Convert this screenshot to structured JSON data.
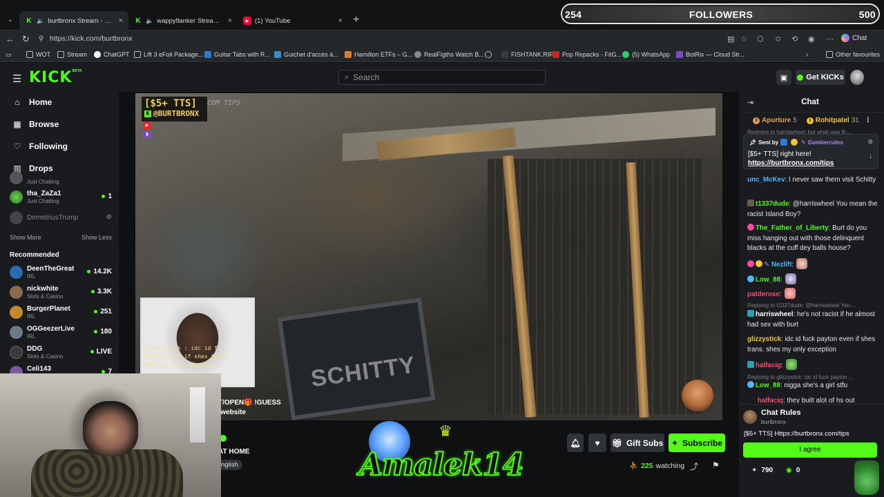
{
  "tabs": [
    {
      "label": "burtbronx Stream - Watch Live"
    },
    {
      "label": "wappyflanker Stream - Watch"
    },
    {
      "label": "(1) YouTube"
    }
  ],
  "followers": {
    "current": "254",
    "label": "FOLLOWERS",
    "goal": "500"
  },
  "address": {
    "url": "https://kick.com/burtbronx",
    "chat_label": "Chat"
  },
  "bookmarks": [
    "WOT",
    "Stream",
    "ChatGPT",
    "Lift 3 eFoil Package...",
    "Guitar Tabs with R...",
    "Guichet d'accès à...",
    "Hamilton ETFs – G...",
    "RealFigths Watch B...",
    "FISHTANK.RIP",
    "Pop Repacks - FitG...",
    "(5) WhatsApp",
    "BotRix — Cloud Str..."
  ],
  "bookmarks_other": "Other favourites",
  "header": {
    "logo": "KICK",
    "logo_tag": "BETA",
    "search_placeholder": "Search",
    "get_kicks": "Get KICKs"
  },
  "sidebar": {
    "nav": [
      {
        "label": "Home"
      },
      {
        "label": "Browse"
      },
      {
        "label": "Following"
      },
      {
        "label": "Drops"
      }
    ],
    "following": [
      {
        "name": "",
        "category": "Just Chatting",
        "viewers": ""
      },
      {
        "name": "tha_ZaZa1",
        "category": "Just Chatting",
        "viewers": "1"
      },
      {
        "name": "DemetriusTrump",
        "category": "",
        "viewers": ""
      }
    ],
    "show_more": "Show More",
    "show_less": "Show Less",
    "recommended_title": "Recommended",
    "recommended": [
      {
        "name": "DeenTheGreat",
        "category": "IRL",
        "viewers": "14.2K",
        "color": "#2b6cb0"
      },
      {
        "name": "nickwhite",
        "category": "Slots & Casino",
        "viewers": "3.3K",
        "color": "#8a6a4a"
      },
      {
        "name": "BurgerPlanet",
        "category": "IRL",
        "viewers": "251",
        "color": "#c48a2a"
      },
      {
        "name": "OGGeezerLive",
        "category": "IRL",
        "viewers": "180",
        "color": "#6a7a8a"
      },
      {
        "name": "DDG",
        "category": "Slots & Casino",
        "viewers": "LIVE",
        "color": "#3a3a3a"
      },
      {
        "name": "Celi143",
        "category": "",
        "viewers": "7",
        "color": "#7a5a9a"
      }
    ]
  },
  "video": {
    "tts_title": "[$5+ TTS]",
    "tts_handle": "@BURTBRONX",
    "com_tips": "COM TIPS",
    "sign_text": "SCHITTY",
    "cam_overlay": "glizzystick : idc id f\npayton even if shes trans.\nshes my only exception"
  },
  "channel_bar": {
    "ticker_line1": "T/OPEN🎁 !GUESS",
    "ticker_line2": "!website",
    "title_fragment": "AT HOME",
    "language": "nglish",
    "overlay_brand": "Amalek14",
    "gift_subs": "Gift Subs",
    "subscribe": "Subscribe",
    "watching_count": "225",
    "watching_label": "watching"
  },
  "chat": {
    "title": "Chat",
    "gifters": [
      {
        "name": "Apurture",
        "count": "5",
        "rank": "3",
        "color": "#e8a060"
      },
      {
        "name": "Rohitpatel",
        "count": "31",
        "rank": "1",
        "color": "#f4c430"
      }
    ],
    "top_reply": "Replying to harriswheel: but what was th...",
    "pinned": {
      "sent_by": "Sent by",
      "sender": "Gumbercules",
      "text": "[$5+ TTS] right here!",
      "link": "https://burtbronx.com/tips"
    },
    "messages": [
      {
        "user": "unc_McKev",
        "color": "#4fb8ff",
        "text": " I never saw them visit Schitty",
        "reply": ""
      },
      {
        "user": "t1337dude",
        "color": "#53fc18",
        "text": " @harriswheel You mean the racist Island Boy?",
        "reply": ""
      },
      {
        "user": "The_Father_of_Liberty",
        "color": "#53fc18",
        "text": " Burt do you miss hanging out with those delinquent blacks at the cuff dey balls house?",
        "reply": ""
      },
      {
        "user": "Nezlift",
        "color": "#4fb8ff",
        "text": "",
        "reply": ""
      },
      {
        "user": "Low_88",
        "color": "#53fc18",
        "text": "",
        "reply": ""
      },
      {
        "user": "patderose",
        "color": "#ff4a6e",
        "text": "",
        "reply": ""
      },
      {
        "user": "harriswheel",
        "color": "#ffffff",
        "text": " he's not racist if he almost had sex with burt",
        "reply": "Replying to t1337dude: @harriswheel You ..."
      },
      {
        "user": "glizzystick",
        "color": "#f4c430",
        "text": " idc id fuck payton even if shes trans. shes my only exception",
        "reply": ""
      },
      {
        "user": "halfacig",
        "color": "#ff4a6e",
        "text": "",
        "reply": ""
      },
      {
        "user": "Low_88",
        "color": "#53fc18",
        "text": " nigga she's a girl stfu",
        "reply": "Replying to glizzystick: idc id fuck payton ..."
      },
      {
        "user": "halfacig",
        "color": "#ff4a6e",
        "text": " they built alot of hs out",
        "reply": ""
      }
    ],
    "rules": {
      "title": "Chat Rules",
      "channel": "burtbronx",
      "body": "[$5+ TTS] Https://burtbronx.com/tips",
      "agree": "I agree"
    },
    "stats": {
      "points": "790",
      "kicks": "0"
    }
  },
  "colors": {
    "accent": "#53fc18",
    "bg": "#0b0e0f",
    "panel": "#191b1f"
  }
}
